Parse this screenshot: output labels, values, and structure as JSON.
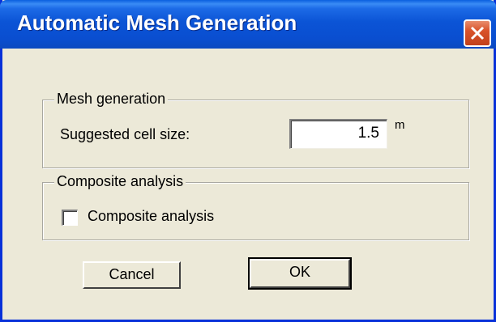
{
  "window": {
    "title": "Automatic Mesh Generation"
  },
  "mesh_group": {
    "legend": "Mesh generation",
    "cell_size_label": "Suggested cell size:",
    "cell_size_value": "1.5",
    "cell_size_unit": "m"
  },
  "composite_group": {
    "legend": "Composite analysis",
    "checkbox_label": "Composite analysis",
    "checked": false
  },
  "buttons": {
    "cancel": "Cancel",
    "ok": "OK"
  },
  "colors": {
    "titlebar": "#0a4ed0",
    "face": "#ece9d8",
    "close": "#d9532a"
  }
}
